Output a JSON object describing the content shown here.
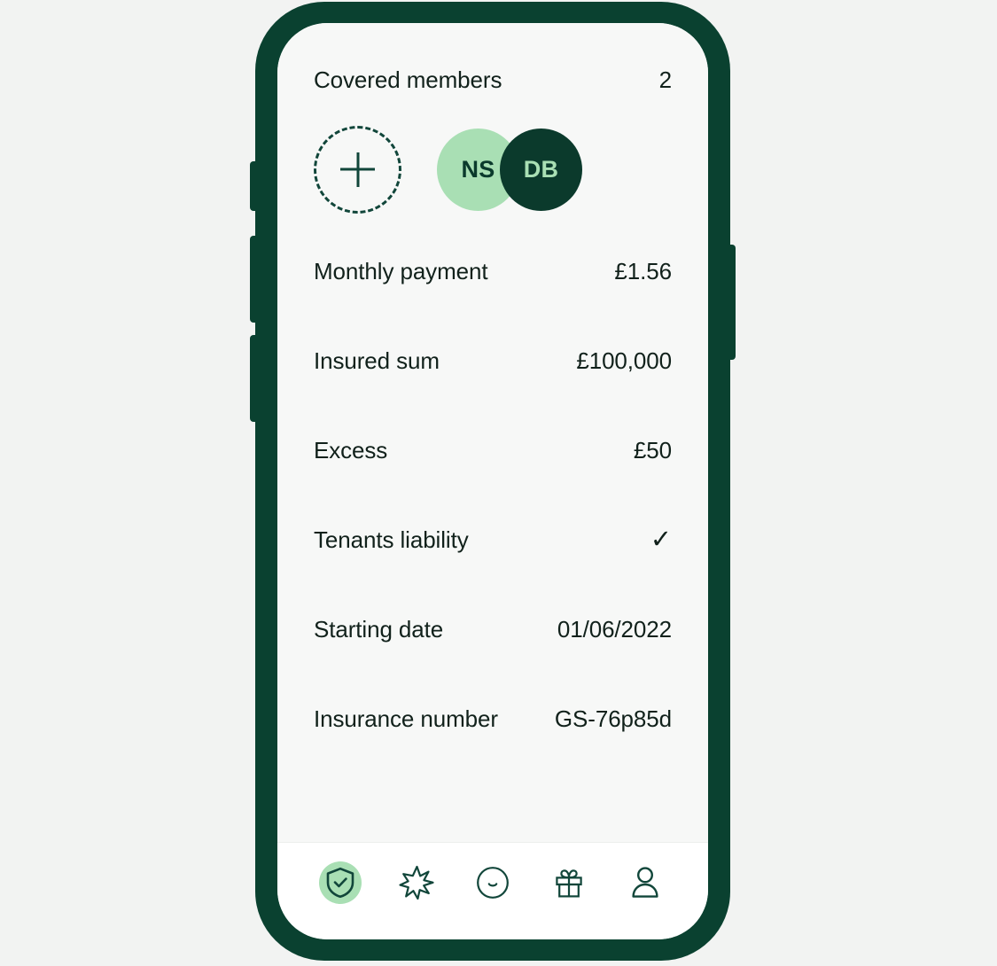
{
  "screen": {
    "header": {
      "label": "Covered members",
      "count": "2"
    },
    "members": {
      "add_label": "+",
      "avatars": [
        {
          "initials": "NS",
          "style": "light"
        },
        {
          "initials": "DB",
          "style": "dark"
        }
      ]
    },
    "details": [
      {
        "label": "Monthly payment",
        "value": "£1.56"
      },
      {
        "label": "Insured sum",
        "value": "£100,000"
      },
      {
        "label": "Excess",
        "value": "£50"
      },
      {
        "label": "Tenants liability",
        "value": "✓"
      },
      {
        "label": "Starting date",
        "value": "01/06/2022"
      },
      {
        "label": "Insurance number",
        "value": "GS-76p85d"
      }
    ],
    "nav": [
      {
        "icon": "shield-check-icon",
        "active": true
      },
      {
        "icon": "sparkle-burst-icon",
        "active": false
      },
      {
        "icon": "smiley-face-icon",
        "active": false
      },
      {
        "icon": "gift-box-icon",
        "active": false
      },
      {
        "icon": "person-icon",
        "active": false
      }
    ]
  },
  "colors": {
    "frame": "#0A4130",
    "screen_bg": "#F7F8F7",
    "nav_bg": "#FFFFFF",
    "text": "#11211B",
    "accent_light": "#A9DFB4",
    "accent_dark": "#0B3A2C",
    "icon_stroke": "#11463A"
  }
}
